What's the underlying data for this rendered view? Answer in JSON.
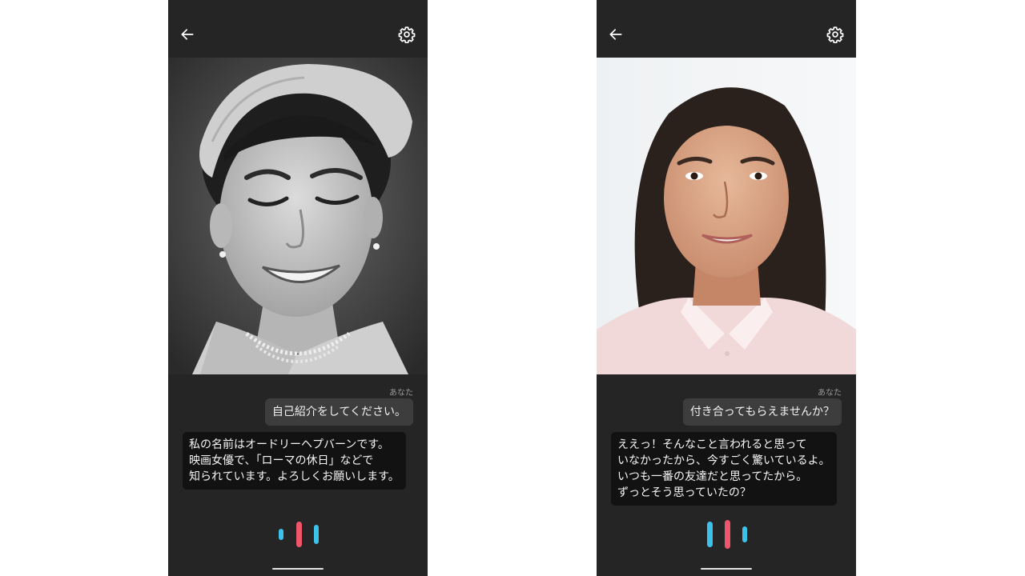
{
  "screens": [
    {
      "speaker_label": "あなた",
      "user_message": "自己紹介をしてください。",
      "ai_message_lines": [
        "私の名前はオードリーヘプバーンです。",
        "映画女優で、「ローマの休日」などで",
        "知られています。よろしくお願いします。"
      ]
    },
    {
      "speaker_label": "あなた",
      "user_message": "付き合ってもらえませんか？",
      "ai_message_lines": [
        "ええっ！そんなこと言われると思って",
        "いなかったから、今すごく驚いているよ。",
        "いつも一番の友達だと思ってたから。",
        "ずっとそう思っていたの？"
      ]
    }
  ],
  "icons": {
    "back": "arrow-left-icon",
    "settings": "gear-icon",
    "voice": "voice-waveform-icon"
  },
  "colors": {
    "app_background": "#252525",
    "user_bubble": "#3d3d3d",
    "ai_bubble": "#121212",
    "wave_blue": "#3cc2ea",
    "wave_red": "#f0566b"
  }
}
